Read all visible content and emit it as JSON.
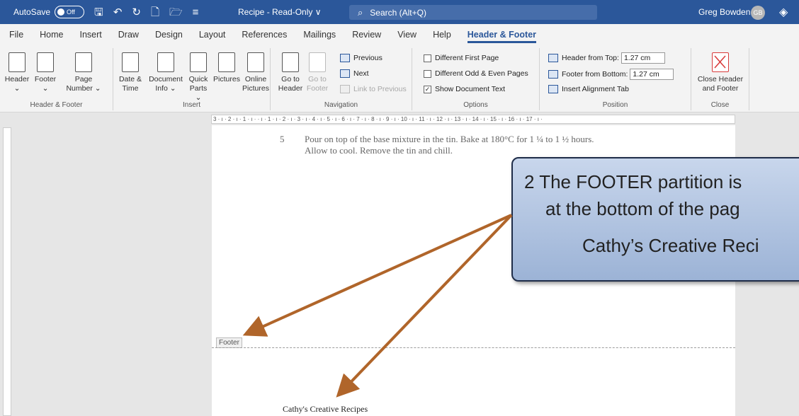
{
  "titlebar": {
    "autosave_label": "AutoSave",
    "autosave_state": "Off",
    "doc_title": "Recipe - Read-Only ∨",
    "search_placeholder": "Search (Alt+Q)",
    "user_name": "Greg Bowden",
    "user_initials": "GB"
  },
  "tabs": [
    "File",
    "Home",
    "Insert",
    "Draw",
    "Design",
    "Layout",
    "References",
    "Mailings",
    "Review",
    "View",
    "Help",
    "Header & Footer"
  ],
  "active_tab": "Header & Footer",
  "ribbon": {
    "header_footer_group": {
      "label": "Header & Footer",
      "header": "Header",
      "header_sub": "⌄",
      "footer": "Footer",
      "footer_sub": "⌄",
      "page_number": "Page",
      "page_number_sub": "Number ⌄"
    },
    "insert_group": {
      "label": "Insert",
      "date_time": "Date &",
      "date_time_sub": "Time",
      "document_info": "Document",
      "document_info_sub": "Info ⌄",
      "quick_parts": "Quick",
      "quick_parts_sub": "Parts ⌄",
      "pictures": "Pictures",
      "online_pictures": "Online",
      "online_pictures_sub": "Pictures"
    },
    "navigation_group": {
      "label": "Navigation",
      "go_to_header": "Go to",
      "go_to_header_sub": "Header",
      "go_to_footer": "Go to",
      "go_to_footer_sub": "Footer",
      "previous": "Previous",
      "next": "Next",
      "link_to_previous": "Link to Previous"
    },
    "options_group": {
      "label": "Options",
      "different_first_page": "Different First Page",
      "different_odd_even": "Different Odd & Even Pages",
      "show_document_text": "Show Document Text"
    },
    "position_group": {
      "label": "Position",
      "header_from_top": "Header from Top:",
      "header_from_top_value": "1.27 cm",
      "footer_from_bottom": "Footer from Bottom:",
      "footer_from_bottom_value": "1.27 cm",
      "insert_alignment_tab": "Insert Alignment Tab"
    },
    "close_group": {
      "label": "Close",
      "close_button": "Close Header",
      "close_button_sub": "and Footer"
    }
  },
  "ruler_text": "3 · ı · 2 · ı · 1 · ı ·   · ı · 1 · ı · 2 · ı · 3 · ı · 4 · ı · 5 · ı · 6 · ı · 7 · ı · 8 · ı · 9 · ı · 10 · ı · 11 · ı · 12 · ı · 13 · ı · 14 · ı · 15 · ı · 16 · ı · 17 · ı ·",
  "document": {
    "step_number": "5",
    "step_line1": "Pour on top of the base mixture in the tin.  Bake at 180°C for 1 ¼ to 1 ½ hours.",
    "step_line2": "Allow to cool.  Remove the tin and chill.",
    "footer_tag": "Footer",
    "footer_text": "Cathy's Creative Recipes"
  },
  "callout": {
    "line1": "2  The FOOTER partition is",
    "line2": "at the bottom of the pag",
    "line3": "Cathy’s Creative Reci"
  },
  "colors": {
    "word_blue": "#2b579a",
    "arrow": "#b0652a"
  }
}
